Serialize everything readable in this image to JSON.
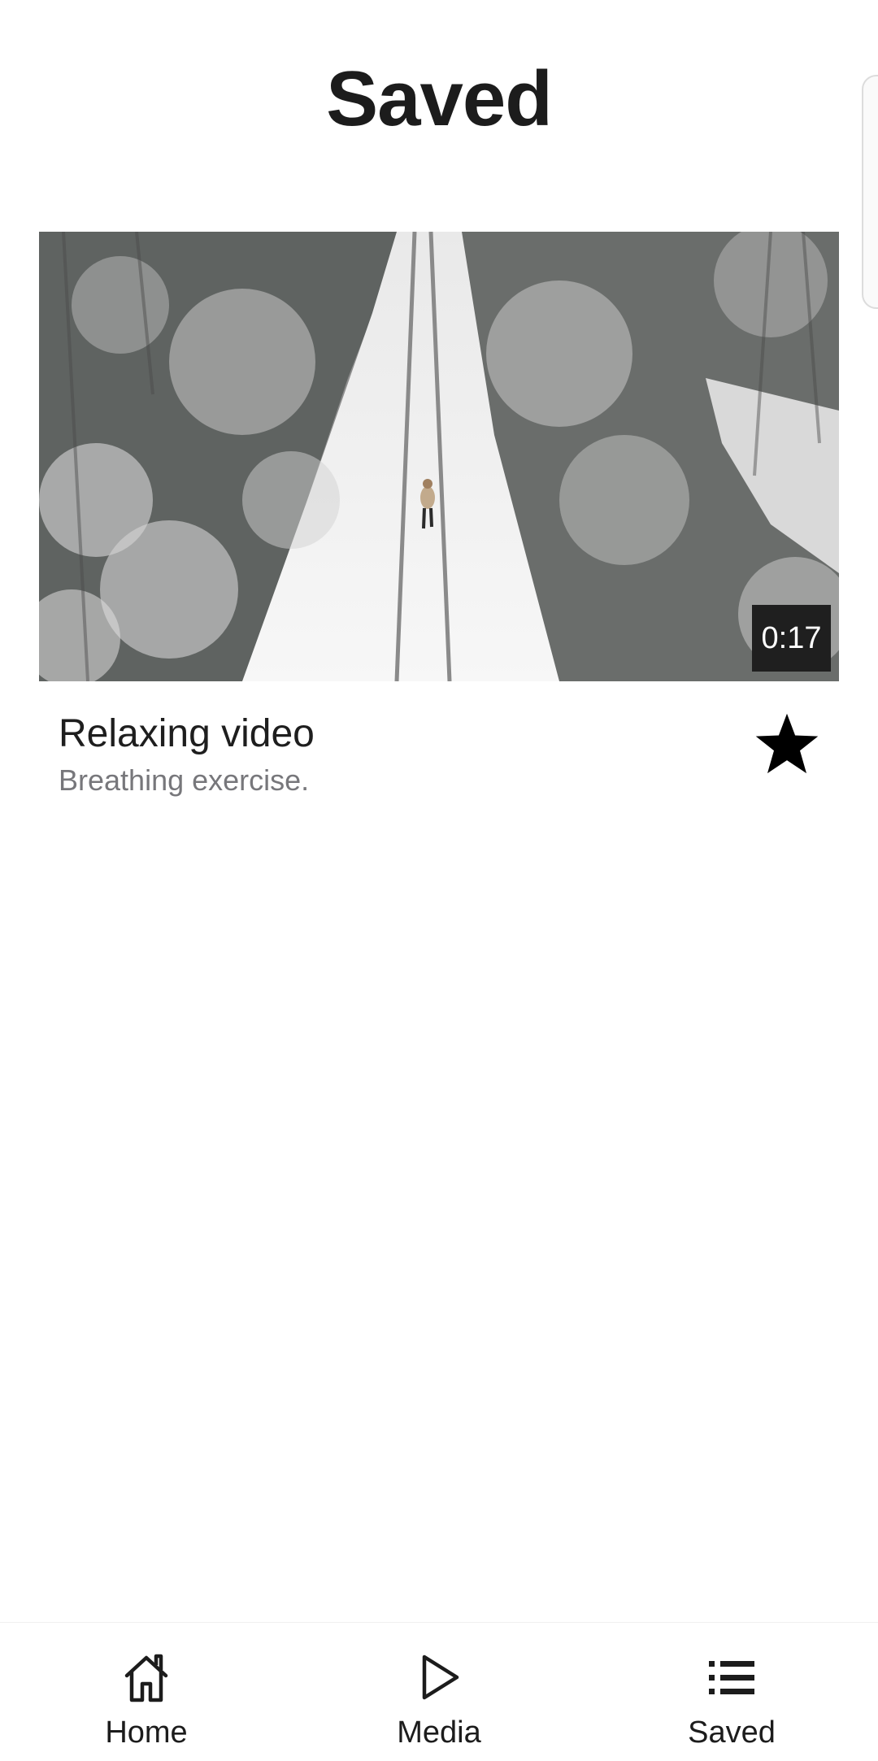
{
  "header": {
    "title": "Saved"
  },
  "saved_videos": [
    {
      "title": "Relaxing video",
      "subtitle": "Breathing exercise.",
      "duration": "0:17",
      "thumbnail_description_icon": "snowy-forest-road-thumbnail",
      "favorite_icon": "star-filled-icon"
    }
  ],
  "bottom_nav": {
    "items": [
      {
        "label": "Home",
        "icon": "home-icon"
      },
      {
        "label": "Media",
        "icon": "play-icon"
      },
      {
        "label": "Saved",
        "icon": "list-icon",
        "active": true
      }
    ]
  },
  "colors": {
    "background": "#ffffff",
    "text_primary": "#1e1e1e",
    "text_secondary": "#77777b",
    "badge_background": "#1f1f1f",
    "badge_text": "#ffffff"
  }
}
